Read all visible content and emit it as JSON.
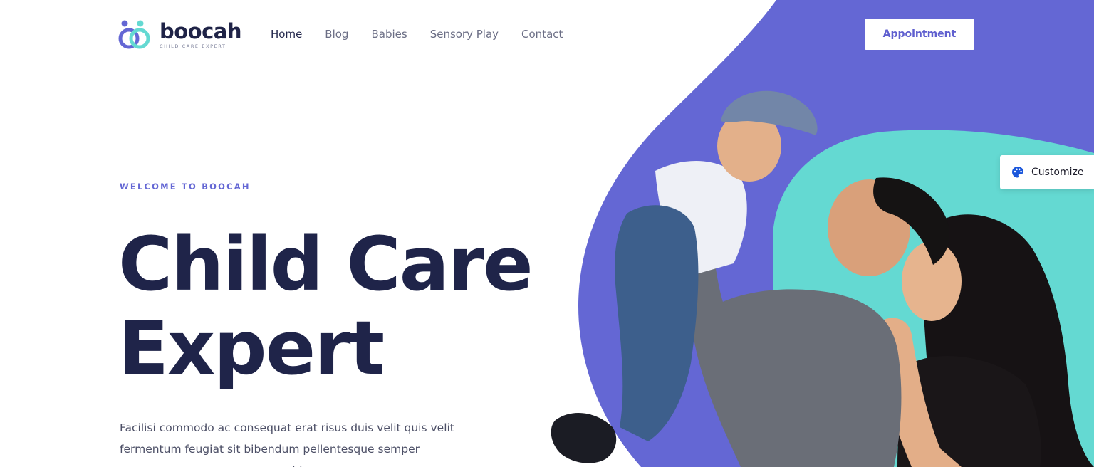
{
  "brand": {
    "name": "boocah",
    "tagline": "CHILD CARE EXPERT"
  },
  "nav": {
    "items": [
      {
        "label": "Home"
      },
      {
        "label": "Blog"
      },
      {
        "label": "Babies"
      },
      {
        "label": "Sensory Play"
      },
      {
        "label": "Contact"
      }
    ]
  },
  "header": {
    "appointment_label": "Appointment"
  },
  "hero": {
    "eyebrow": "WELCOME TO BOOCAH",
    "title_line1": "Child Care",
    "title_line2": "Expert",
    "description": "Facilisi commodo ac consequat erat risus duis velit quis velit fermentum feugiat sit bibendum pellentesque semper maecenas posuere cursus gravida"
  },
  "customize": {
    "label": "Customize",
    "icon": "palette-icon"
  },
  "colors": {
    "purple": "#6467d4",
    "teal": "#64d9d2",
    "navy": "#1f2449",
    "white": "#ffffff"
  }
}
